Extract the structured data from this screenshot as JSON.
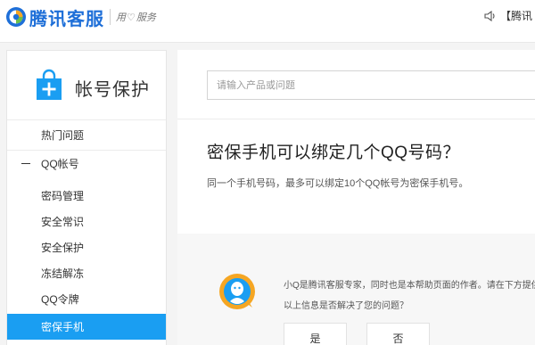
{
  "header": {
    "logo_text": "腾讯客服",
    "slogan_left": "用",
    "slogan_right": "服务",
    "announcement": "【腾讯"
  },
  "sidebar": {
    "title": "帐号保护",
    "items": [
      {
        "label": "热门问题"
      },
      {
        "label": "QQ帐号"
      },
      {
        "label": "密码管理"
      },
      {
        "label": "安全常识"
      },
      {
        "label": "安全保护"
      },
      {
        "label": "冻结解冻"
      },
      {
        "label": "QQ令牌"
      },
      {
        "label": "密保手机"
      }
    ],
    "active_item": "密保手机"
  },
  "search": {
    "placeholder": "请输入产品或问题"
  },
  "article": {
    "question": "密保手机可以绑定几个QQ号码？",
    "answer": "同一个手机号码，最多可以绑定10个QQ帐号为密保手机号。"
  },
  "feedback": {
    "intro": "小Q是腾讯客服专家，同时也是本帮助页面的作者。请在下方提供反馈",
    "question": "以上信息是否解决了您的问题？",
    "yes_label": "是",
    "no_label": "否"
  },
  "colors": {
    "accent": "#1a9ef2",
    "brand": "#1e6fd8"
  }
}
